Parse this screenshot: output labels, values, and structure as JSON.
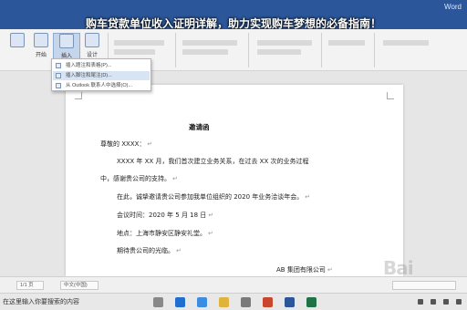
{
  "banner": {
    "title": "购车贷款单位收入证明详解，助力实现购车梦想的必备指南！"
  },
  "titlebar": {
    "app_suffix": "Word"
  },
  "ribbon": {
    "buttons": [
      {
        "label": "开始"
      },
      {
        "label": "插入"
      },
      {
        "label": "设计"
      }
    ]
  },
  "menu": {
    "items": [
      {
        "label": "插入题注和表格(P)..."
      },
      {
        "label": "插入脚注和尾注(D)..."
      },
      {
        "label": "从 Outlook 联系人中选择(O)..."
      }
    ]
  },
  "document": {
    "title": "邀请函",
    "greeting": "尊敬的 XXXX：",
    "p1a": "XXXX 年 XX 月，我们首次建立业务关系，在过去 XX 次的业务过程",
    "p1b": "中，感谢贵公司的支持。",
    "p2": "在此，诚挚邀请贵公司参加我单位组织的 2020 年业务洽谈年会。",
    "time": "会议时间：2020 年 5 月 18 日",
    "place": "地点：上海市静安区静安礼堂。",
    "expect": "期待贵公司的光临。",
    "sign": "AB 集团有限公司",
    "para_mark": "↵"
  },
  "statusbar": {
    "page": "1/1 页",
    "lang": "中文(中国)"
  },
  "taskbar": {
    "search_text": "在这里输入你要搜索的内容"
  },
  "colors": {
    "titlebar": "#2b579a",
    "ribbon": "#f3f3f3",
    "menu_selected": "#d7e4f4"
  }
}
